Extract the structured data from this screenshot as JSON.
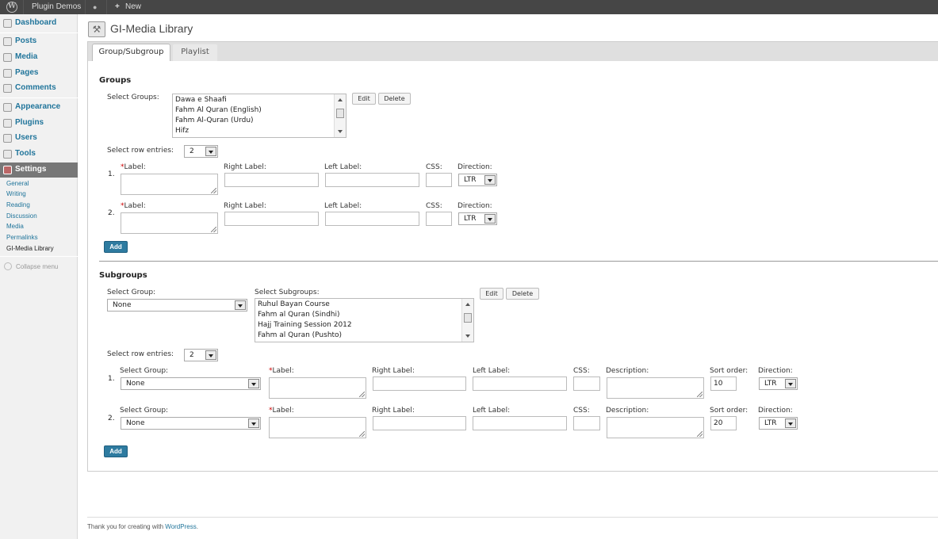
{
  "admin_bar": {
    "site": "Plugin Demos",
    "new": "New",
    "new_plus": "+",
    "comments_glyph": "●",
    "wp_glyph": "W"
  },
  "sidebar": {
    "items": [
      {
        "label": "Dashboard"
      },
      {
        "label": "Posts"
      },
      {
        "label": "Media"
      },
      {
        "label": "Pages"
      },
      {
        "label": "Comments"
      },
      {
        "label": "Appearance"
      },
      {
        "label": "Plugins"
      },
      {
        "label": "Users"
      },
      {
        "label": "Tools"
      },
      {
        "label": "Settings"
      }
    ],
    "submenu": [
      "General",
      "Writing",
      "Reading",
      "Discussion",
      "Media",
      "Permalinks",
      "GI-Media Library"
    ],
    "collapse": "Collapse menu"
  },
  "page": {
    "title": "GI-Media Library",
    "icon": "⚒"
  },
  "tabs": [
    {
      "label": "Group/Subgroup"
    },
    {
      "label": "Playlist"
    }
  ],
  "groups": {
    "heading": "Groups",
    "select_label": "Select Groups:",
    "list": [
      "Dawa e Shaafi",
      "Fahm Al Quran (English)",
      "Fahm Al-Quran (Urdu)",
      "Hifz"
    ],
    "edit": "Edit",
    "delete": "Delete",
    "row_entries_label": "Select row entries:",
    "row_entries_value": "2",
    "rows": [
      {
        "num": "1.",
        "direction": "LTR"
      },
      {
        "num": "2.",
        "direction": "LTR"
      }
    ],
    "label_label": "Label:",
    "right_label": "Right Label:",
    "left_label": "Left Label:",
    "css_label": "CSS:",
    "direction_label": "Direction:",
    "add": "Add"
  },
  "subgroups": {
    "heading": "Subgroups",
    "select_group_label": "Select Group:",
    "select_group_value": "None",
    "select_subgroups_label": "Select Subgroups:",
    "list": [
      "Ruhul Bayan Course",
      "Fahm al Quran (Sindhi)",
      "Hajj Training Session 2012",
      "Fahm al Quran (Pushto)"
    ],
    "edit": "Edit",
    "delete": "Delete",
    "row_entries_label": "Select row entries:",
    "row_entries_value": "2",
    "rows": [
      {
        "num": "1.",
        "group": "None",
        "sort": "10",
        "direction": "LTR"
      },
      {
        "num": "2.",
        "group": "None",
        "sort": "20",
        "direction": "LTR"
      }
    ],
    "group_label": "Select Group:",
    "label_label": "Label:",
    "right_label": "Right Label:",
    "left_label": "Left Label:",
    "css_label": "CSS:",
    "description_label": "Description:",
    "sort_label": "Sort order:",
    "direction_label": "Direction:",
    "add": "Add"
  },
  "footer": {
    "text": "Thank you for creating with ",
    "link": "WordPress",
    "end": "."
  }
}
